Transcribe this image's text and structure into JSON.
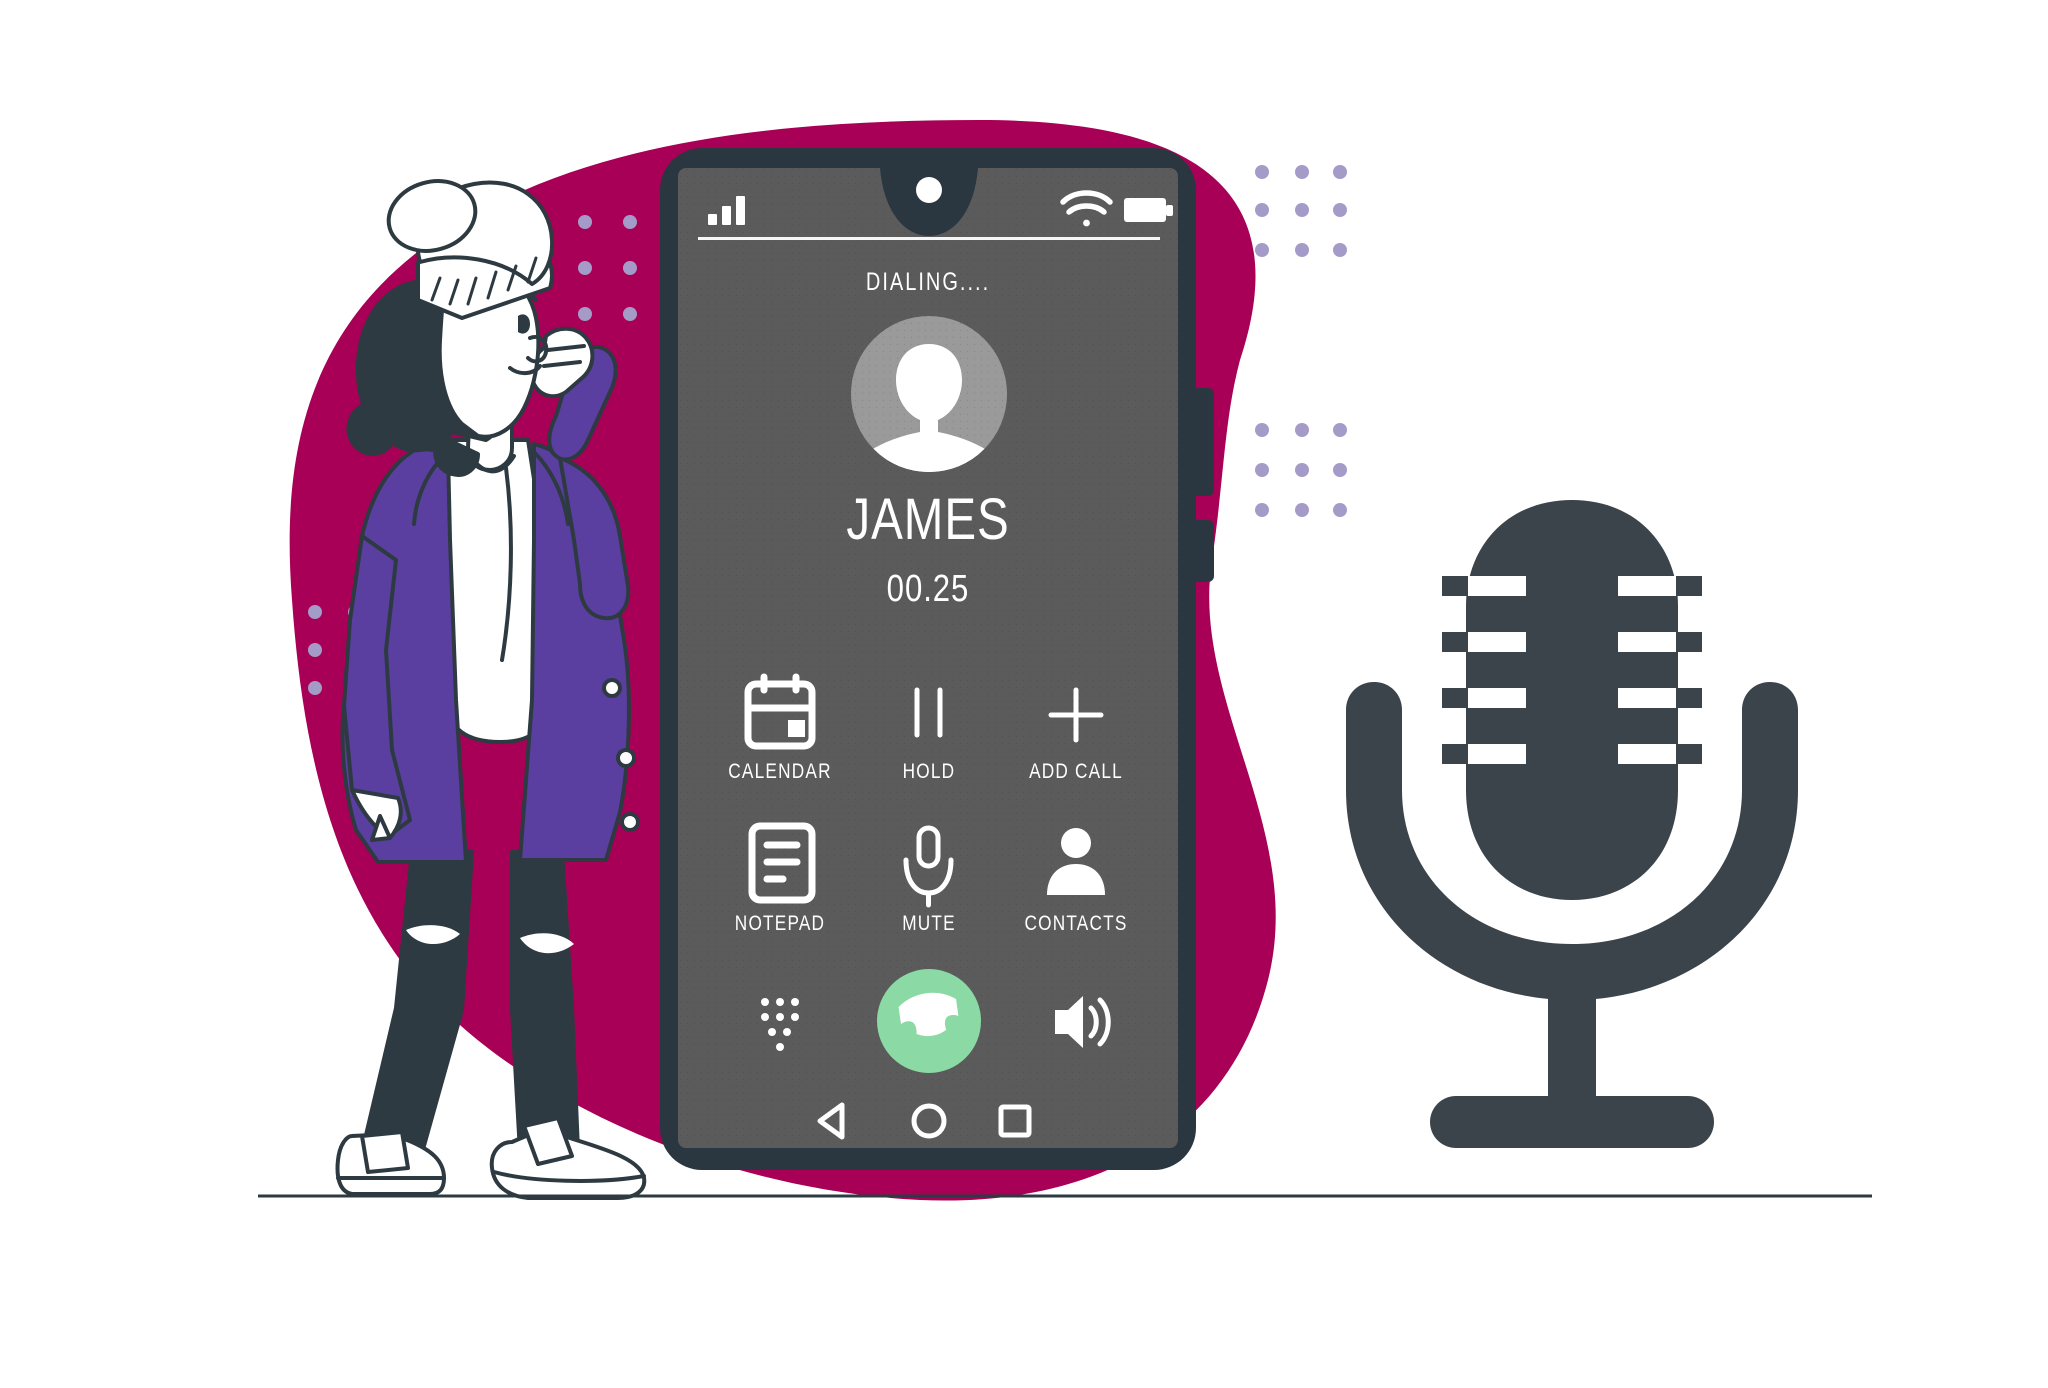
{
  "scene": {
    "title": "Phone call illustration",
    "background_color": "#ffffff",
    "blob_color": "#A80056",
    "dot_color": "#A49BC8",
    "ground_line_color": "#2E3A41"
  },
  "phone": {
    "frame_color": "#2B3740",
    "screen_color": "#5B5B5B",
    "status_bar": {
      "signal_icon": "signal-bars-icon",
      "wifi_icon": "wifi-icon",
      "battery_icon": "battery-icon",
      "camera_icon": "front-camera-icon"
    },
    "call_screen": {
      "status_text": "DIALING....",
      "avatar_icon": "default-avatar-icon",
      "caller_name": "JAMES",
      "timer": "00.25",
      "actions": [
        {
          "label": "CALENDAR",
          "icon": "calendar-icon"
        },
        {
          "label": "HOLD",
          "icon": "pause-icon"
        },
        {
          "label": "ADD CALL",
          "icon": "plus-icon"
        },
        {
          "label": "NOTEPAD",
          "icon": "notepad-icon"
        },
        {
          "label": "MUTE",
          "icon": "microphone-icon"
        },
        {
          "label": "CONTACTS",
          "icon": "contacts-person-icon"
        }
      ],
      "bottom_bar": {
        "keypad_icon": "keypad-dots-icon",
        "end_call_icon": "phone-handset-icon",
        "end_call_color": "#8BD9A4",
        "speaker_icon": "speaker-icon"
      }
    },
    "nav_bar": {
      "back_icon": "back-triangle-icon",
      "home_icon": "home-circle-icon",
      "recents_icon": "recents-square-icon"
    }
  },
  "character": {
    "name": "person-on-phone",
    "hat_color": "#FFFFFF",
    "hair_color": "#2E3A41",
    "coat_color": "#5A3FA0",
    "shirt_color": "#FFFFFF",
    "jeans_color": "#2E3A41",
    "shoe_color": "#FFFFFF"
  },
  "microphone_graphic": {
    "name": "retro-microphone-icon",
    "color": "#3C444B",
    "slot_count": 4
  }
}
